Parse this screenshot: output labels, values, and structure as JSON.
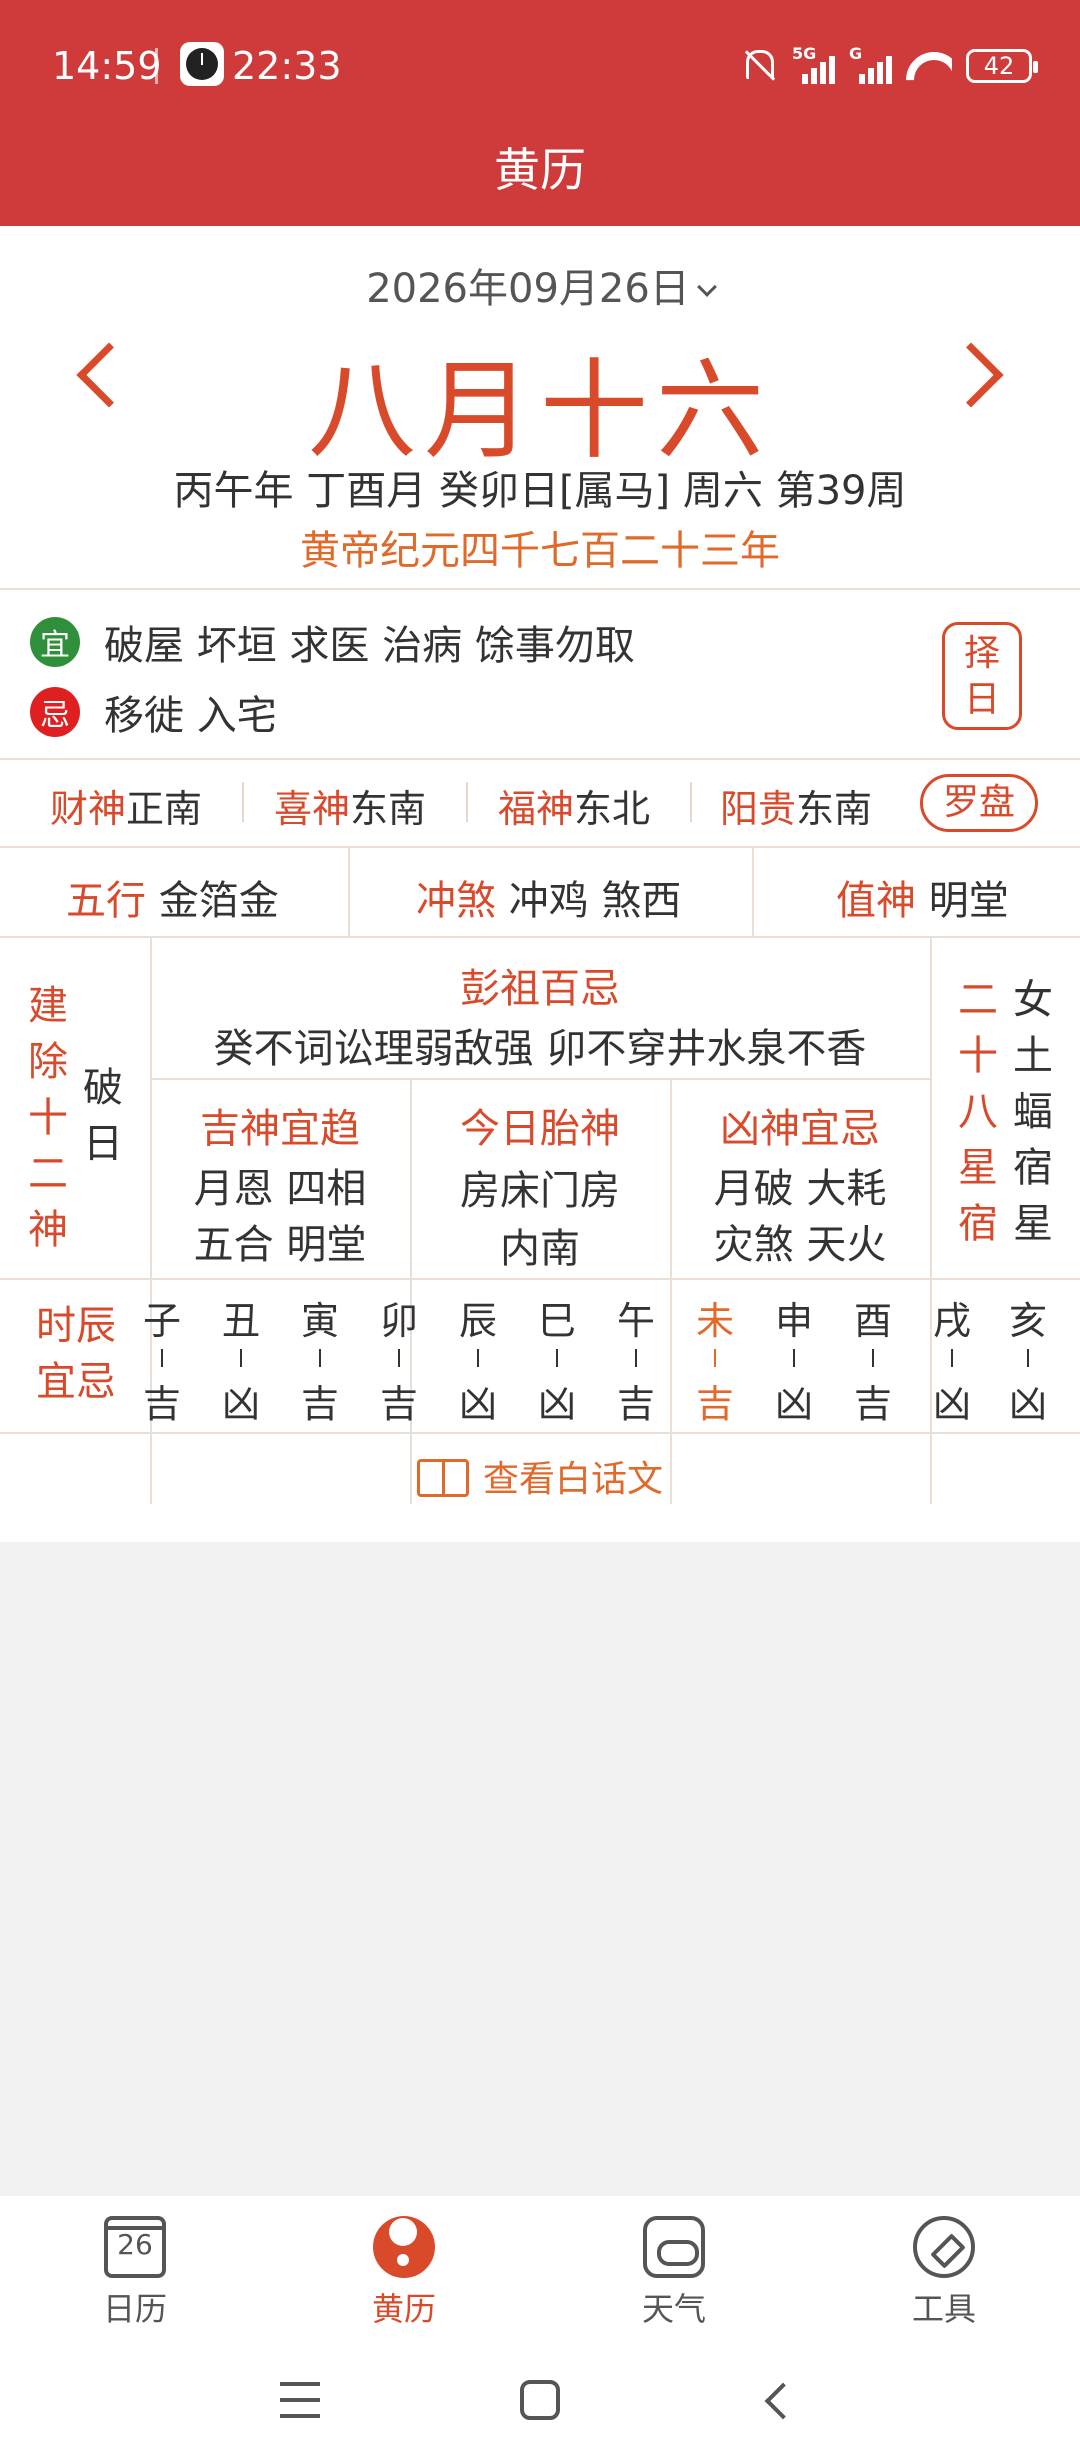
{
  "status_bar": {
    "time": "14:59",
    "clock_time": "22:33",
    "battery": "42",
    "net1": "5G",
    "net2": "G"
  },
  "header": {
    "title": "黄历"
  },
  "date": {
    "selector": "2026年09月26日",
    "lunar": "八月十六",
    "ganzhi": "丙午年 丁酉月 癸卯日[属马] 周六 第39周",
    "era": "黄帝纪元四千七百二十三年"
  },
  "yiji": {
    "yi_badge": "宜",
    "yi_text": "破屋 坏垣 求医 治病 馀事勿取",
    "ji_badge": "忌",
    "ji_text": "移徙 入宅",
    "zeri": "择日"
  },
  "gods": [
    {
      "label": "财神",
      "value": "正南"
    },
    {
      "label": "喜神",
      "value": "东南"
    },
    {
      "label": "福神",
      "value": "东北"
    },
    {
      "label": "阳贵",
      "value": "东南"
    }
  ],
  "luopan": "罗盘",
  "wuxing": {
    "label": "五行",
    "value": "金箔金"
  },
  "chongsha": {
    "label": "冲煞",
    "value": "冲鸡 煞西"
  },
  "zhishen": {
    "label": "值神",
    "value": "明堂"
  },
  "jianchu": {
    "label_chars": [
      "建",
      "除",
      "十",
      "二",
      "神"
    ],
    "value": [
      "破",
      "日"
    ]
  },
  "pengzu": {
    "label": "彭祖百忌",
    "text": "癸不词讼理弱敌强 卯不穿井水泉不香"
  },
  "jishen": {
    "label": "吉神宜趋",
    "line1": "月恩 四相",
    "line2": "五合 明堂"
  },
  "taishen": {
    "label": "今日胎神",
    "line1": "房床门房",
    "line2": "内南"
  },
  "xiongshen": {
    "label": "凶神宜忌",
    "line1": "月破 大耗",
    "line2": "灾煞 天火"
  },
  "xiu28": {
    "label_chars": [
      "二",
      "十",
      "八",
      "星",
      "宿"
    ],
    "value_chars": [
      "女",
      "土",
      "蝠",
      "宿",
      "星"
    ]
  },
  "hours": {
    "label1": "时辰",
    "label2": "宜忌",
    "items": [
      {
        "branch": "子",
        "luck": "吉"
      },
      {
        "branch": "丑",
        "luck": "凶"
      },
      {
        "branch": "寅",
        "luck": "吉"
      },
      {
        "branch": "卯",
        "luck": "吉"
      },
      {
        "branch": "辰",
        "luck": "凶"
      },
      {
        "branch": "巳",
        "luck": "凶"
      },
      {
        "branch": "午",
        "luck": "吉"
      },
      {
        "branch": "未",
        "luck": "吉"
      },
      {
        "branch": "申",
        "luck": "凶"
      },
      {
        "branch": "酉",
        "luck": "吉"
      },
      {
        "branch": "戌",
        "luck": "凶"
      },
      {
        "branch": "亥",
        "luck": "凶"
      }
    ]
  },
  "vernacular": "查看白话文",
  "nav": [
    {
      "label": "日历",
      "icon": "calendar-icon",
      "badge": "26"
    },
    {
      "label": "黄历",
      "icon": "yinyang-icon"
    },
    {
      "label": "天气",
      "icon": "weather-icon"
    },
    {
      "label": "工具",
      "icon": "compass-icon"
    }
  ],
  "colors": {
    "header": "#cf3b3b",
    "accent": "#d94a2b",
    "orange": "#e06a2a",
    "yi": "#2f8f3a",
    "ji": "#e02020"
  }
}
